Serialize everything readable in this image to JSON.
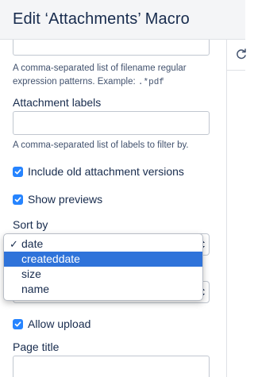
{
  "header": {
    "title": "Edit ‘Attachments’ Macro"
  },
  "form": {
    "filename_help_line1": "A comma-separated list of filename regular",
    "filename_help_line2_prefix": "expression patterns. Example: ",
    "filename_help_example": ".*pdf",
    "attachment_labels_label": "Attachment labels",
    "attachment_labels_value": "",
    "attachment_labels_help": "A comma-separated list of labels to filter by.",
    "include_old_versions_label": "Include old attachment versions",
    "show_previews_label": "Show previews",
    "sort_by_label": "Sort by",
    "allow_upload_label": "Allow upload",
    "page_title_label": "Page title",
    "checkbox_checked": {
      "include_old_versions": true,
      "show_previews": true,
      "allow_upload": true
    }
  },
  "sort_dropdown": {
    "checked_glyph": "✓",
    "options": [
      "date",
      "createddate",
      "size",
      "name"
    ],
    "selected_option": "date",
    "highlighted_option": "createddate"
  },
  "colors": {
    "accent": "#2684ff",
    "highlight": "#2f73da",
    "header_bg": "#f4f5f7"
  },
  "icons": {
    "right_panel": "refresh-icon"
  }
}
